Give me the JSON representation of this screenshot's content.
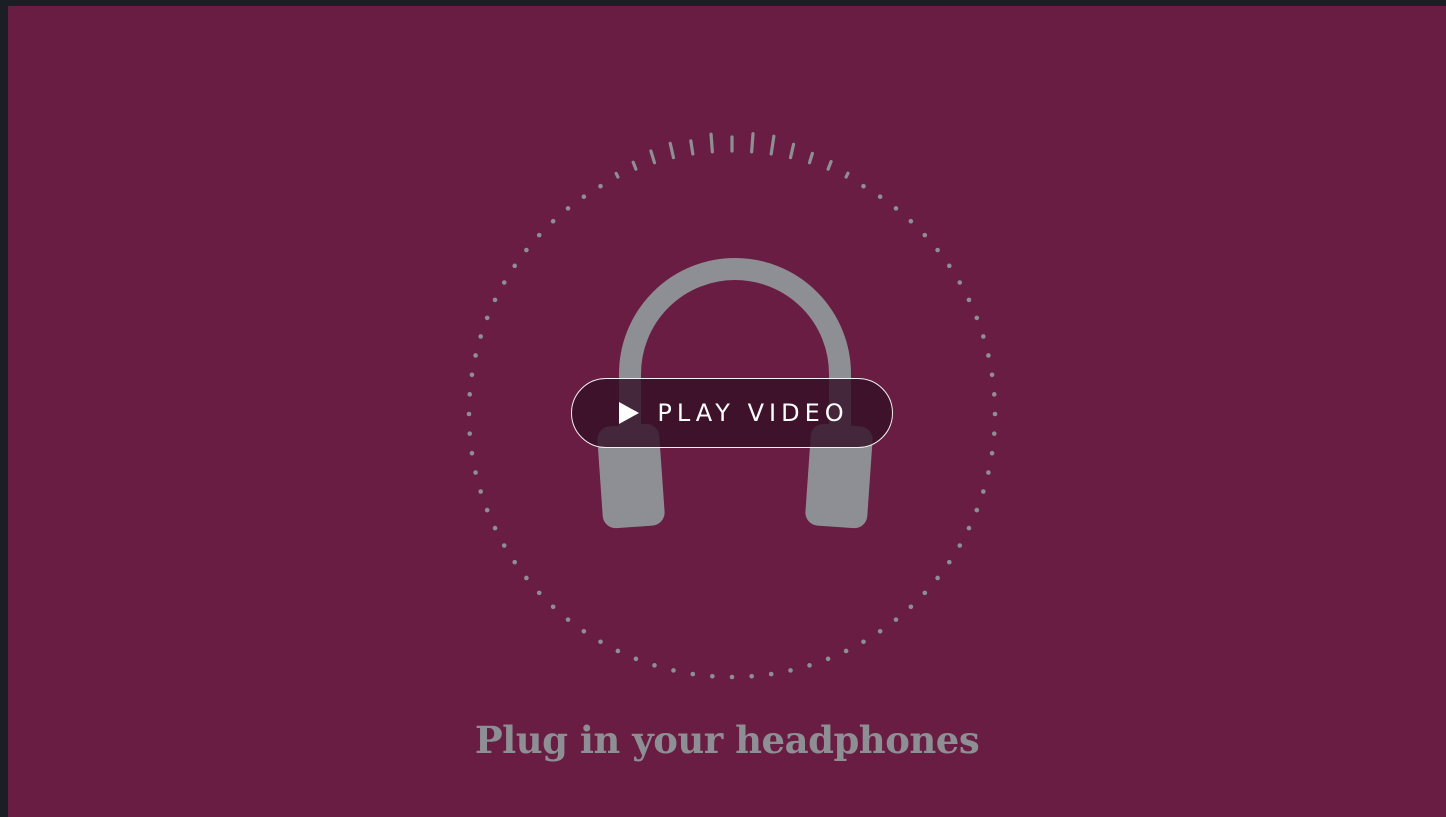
{
  "hero": {
    "caption": "Plug in your headphones",
    "play_button": {
      "label": "PLAY VIDEO",
      "icon": "play-icon"
    },
    "illustration": {
      "icon": "headphones-icon",
      "ring_icon": "sound-wave-ring-icon"
    }
  },
  "colors": {
    "background": "#6a1d43",
    "outer_frame": "#1b1e25",
    "illustration": "#8d8f95",
    "button_fill": "#341026",
    "button_border": "#f1f1f1",
    "button_text": "#ffffff"
  }
}
